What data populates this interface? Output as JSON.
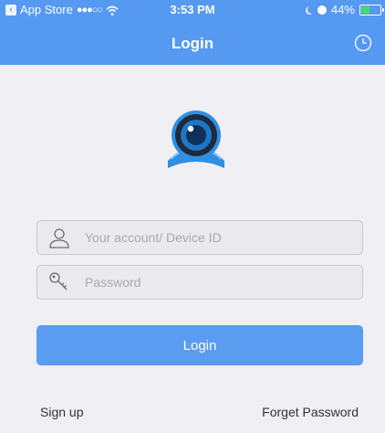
{
  "status_bar": {
    "back_app": "App Store",
    "signal": "●●●○○",
    "time": "3:53 PM",
    "battery_percent": "44%",
    "battery_level": 0.44
  },
  "nav": {
    "title": "Login",
    "history_icon": "clock-icon"
  },
  "logo": {
    "icon": "camera-logo-icon"
  },
  "form": {
    "account_placeholder": "Your account/ Device ID",
    "account_value": "",
    "account_icon": "user-icon",
    "password_placeholder": "Password",
    "password_value": "",
    "password_icon": "key-icon",
    "login_label": "Login"
  },
  "links": {
    "signup": "Sign up",
    "forget_password": "Forget Password"
  },
  "colors": {
    "accent": "#5599f1",
    "background": "#efeff4",
    "battery_green": "#4cd964"
  }
}
